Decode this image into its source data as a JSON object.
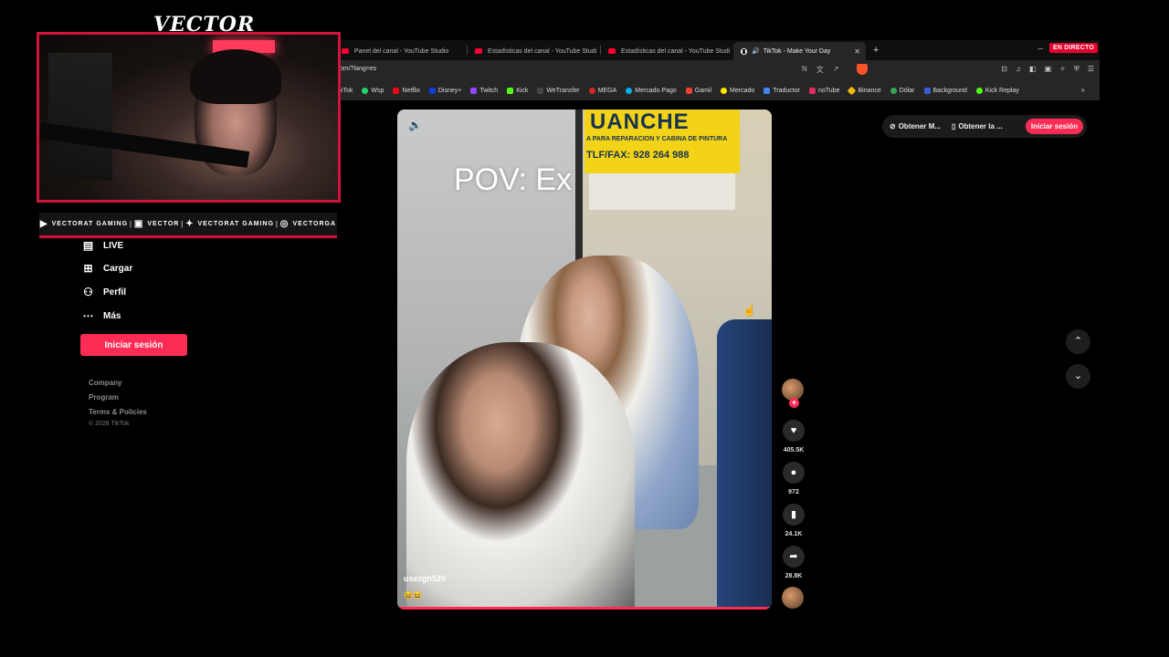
{
  "browser": {
    "tabs": [
      {
        "label": "Panel del canal - YouTube Studio",
        "icon": "youtube-icon"
      },
      {
        "label": "Estadísticas del canal - YouTube Studi",
        "icon": "youtube-icon"
      },
      {
        "label": "Estadísticas del canal - YouTube Studi",
        "icon": "youtube-icon"
      },
      {
        "label": "TikTok - Make Your Day",
        "icon": "tiktok-icon",
        "active": true
      }
    ],
    "new_tab": "+",
    "live_badge": "EN DIRECTO",
    "url": "om/?lang=es",
    "bookmarks": [
      {
        "label": "kTok",
        "color": "#111111"
      },
      {
        "label": "Wsp",
        "color": "#25d366"
      },
      {
        "label": "Netflix",
        "color": "#e50914"
      },
      {
        "label": "Disney+",
        "color": "#113ccf"
      },
      {
        "label": "Twitch",
        "color": "#9146ff"
      },
      {
        "label": "Kick",
        "color": "#53fc18"
      },
      {
        "label": "WeTransfer",
        "color": "#444444"
      },
      {
        "label": "MEGA",
        "color": "#d9272e"
      },
      {
        "label": "Mercado Pago",
        "color": "#00b1ea"
      },
      {
        "label": "Gamil",
        "color": "#ea4335"
      },
      {
        "label": "Mercado",
        "color": "#ffe600"
      },
      {
        "label": "Traductor",
        "color": "#4285f4"
      },
      {
        "label": "noTube",
        "color": "#e02f5f"
      },
      {
        "label": "Binance",
        "color": "#f0b90b"
      },
      {
        "label": "Dólar",
        "color": "#3aa655"
      },
      {
        "label": "Background",
        "color": "#3b5bdb"
      },
      {
        "label": "Kick Replay",
        "color": "#53fc18"
      }
    ]
  },
  "overlay": {
    "logo": "VECTOR",
    "socials": [
      {
        "icon": "youtube-icon",
        "label": "VECTORAT GAMING"
      },
      {
        "icon": "twitch-icon",
        "label": "VECTOR"
      },
      {
        "icon": "twitter-icon",
        "label": "VECTORAT GAMING"
      },
      {
        "icon": "instagram-icon",
        "label": "VECTORGA"
      }
    ]
  },
  "sidebar": {
    "items": [
      {
        "label": "LIVE",
        "icon": "live-icon"
      },
      {
        "label": "Cargar",
        "icon": "upload-icon"
      },
      {
        "label": "Perfil",
        "icon": "profile-icon"
      },
      {
        "label": "Más",
        "icon": "more-icon"
      }
    ],
    "login_button": "Iniciar sesión",
    "footer_links": [
      "Company",
      "Program",
      "Terms & Policies"
    ],
    "copyright": "© 2026 TikTok"
  },
  "video": {
    "overlay_text": "POV: Ex",
    "username": "usezgh520",
    "caption_emoji": "😆😆",
    "sign_big": "UANCHE",
    "sign_line1": "A PARA REPARACION Y CABINA DE PINTURA",
    "sign_line2": "TLF/FAX: 928 264 988"
  },
  "actions": {
    "likes": "405.5K",
    "comments": "972",
    "saves": "24.1K",
    "shares": "28.8K"
  },
  "topbar": {
    "pill1": "Obtener M...",
    "pill2": "Obtener la ...",
    "login": "Iniciar sesión"
  },
  "colors": {
    "accent": "#fe2c55",
    "overlay_red": "#d0143c"
  }
}
